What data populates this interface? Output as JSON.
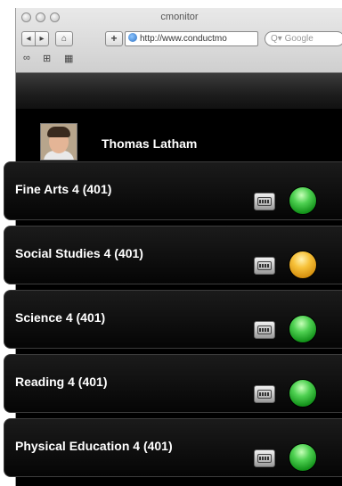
{
  "browser": {
    "title": "cmonitor",
    "back_label": "◂",
    "forward_label": "▸",
    "home_label": "⌂",
    "add_label": "+",
    "address": "http://www.conductmo",
    "search_placeholder": "Q▾ Google",
    "bookmarks": [
      "∞",
      "⊞",
      "▦"
    ]
  },
  "user": {
    "name": "Thomas Latham"
  },
  "courses": [
    {
      "name": "Fine Arts 4 (401)",
      "status": "green"
    },
    {
      "name": "Social Studies 4 (401)",
      "status": "yellow"
    },
    {
      "name": "Science 4 (401)",
      "status": "green"
    },
    {
      "name": "Reading 4 (401)",
      "status": "green"
    },
    {
      "name": "Physical Education 4 (401)",
      "status": "green"
    }
  ],
  "colors": {
    "green": "#2fb534",
    "yellow": "#f2b426"
  }
}
